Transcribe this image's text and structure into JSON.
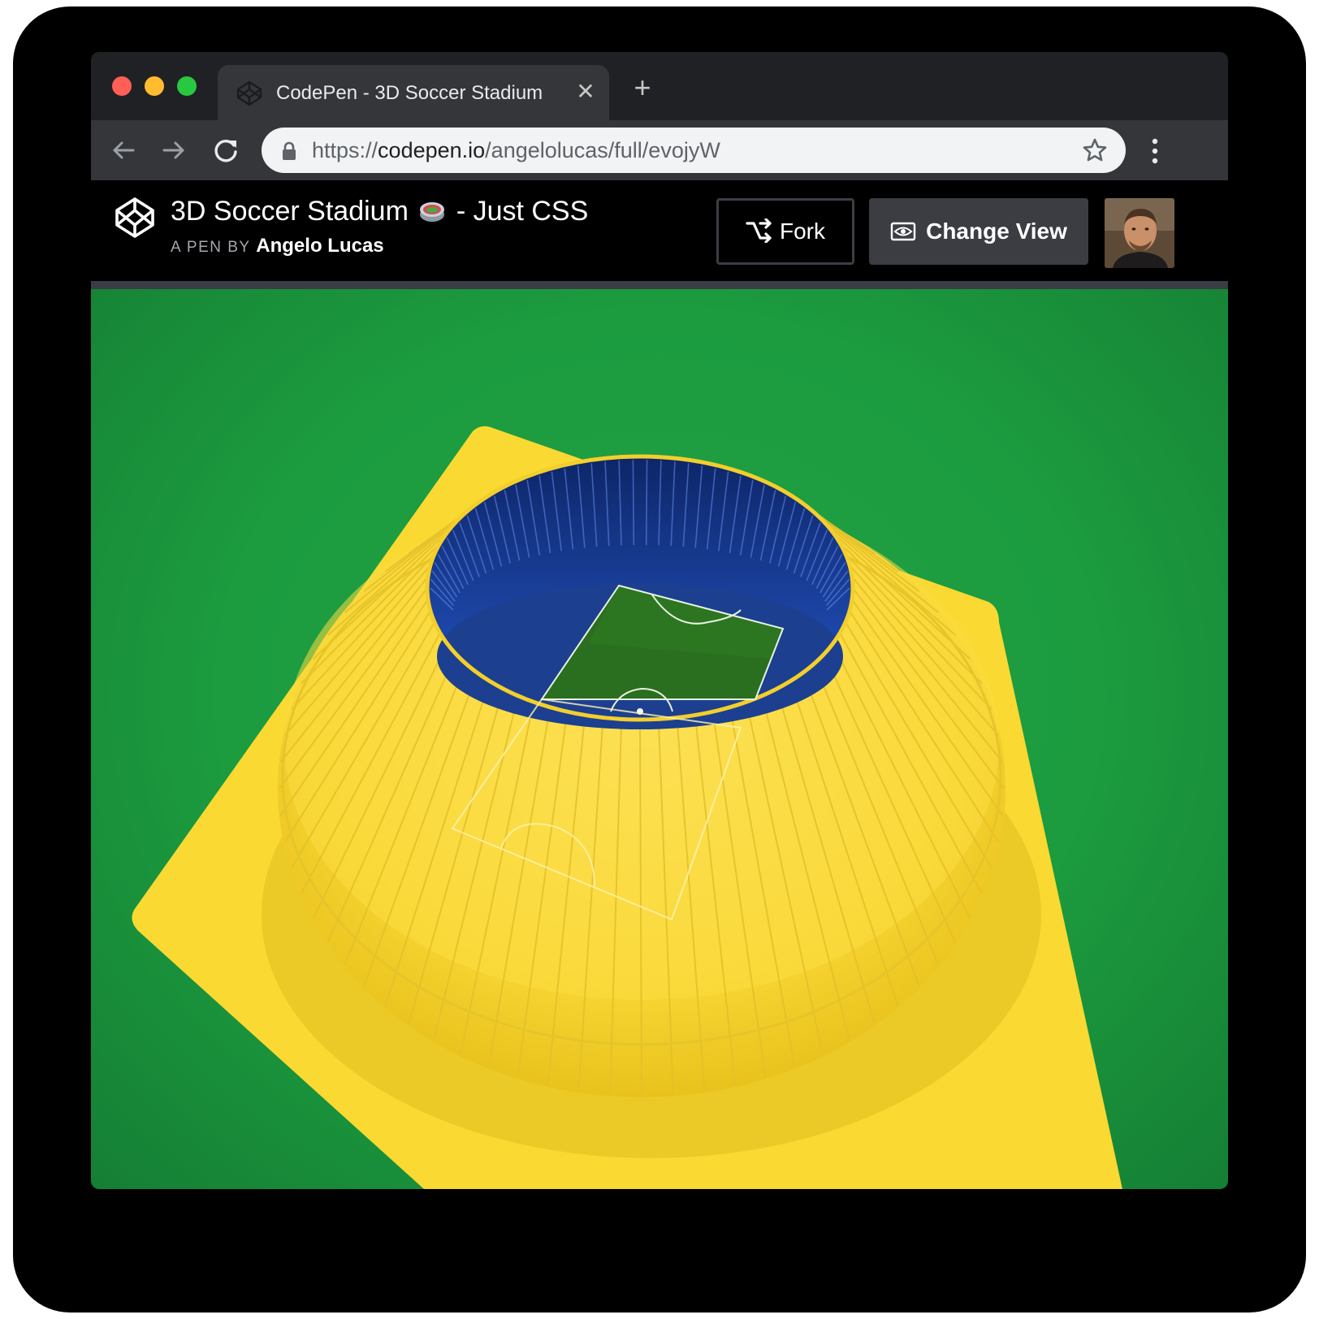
{
  "browser": {
    "tab": {
      "title": "CodePen - 3D Soccer Stadium",
      "close_glyph": "✕",
      "icon": "codepen-icon"
    },
    "new_tab_glyph": "+",
    "url": {
      "scheme": "https://",
      "host": "codepen.io",
      "path": "/angelolucas/full/evojyW"
    }
  },
  "pen": {
    "title_main": "3D Soccer Stadium",
    "title_suffix": "- Just CSS",
    "byline_prefix": "A PEN BY",
    "author": "Angelo Lucas",
    "fork_label": "Fork",
    "change_view_label": "Change View"
  },
  "colors": {
    "field_green": "#1c9b3f",
    "stadium_yellow": "#fbd933",
    "stands_blue": "#1c3f90",
    "pitch_green": "#2a6e1f"
  }
}
